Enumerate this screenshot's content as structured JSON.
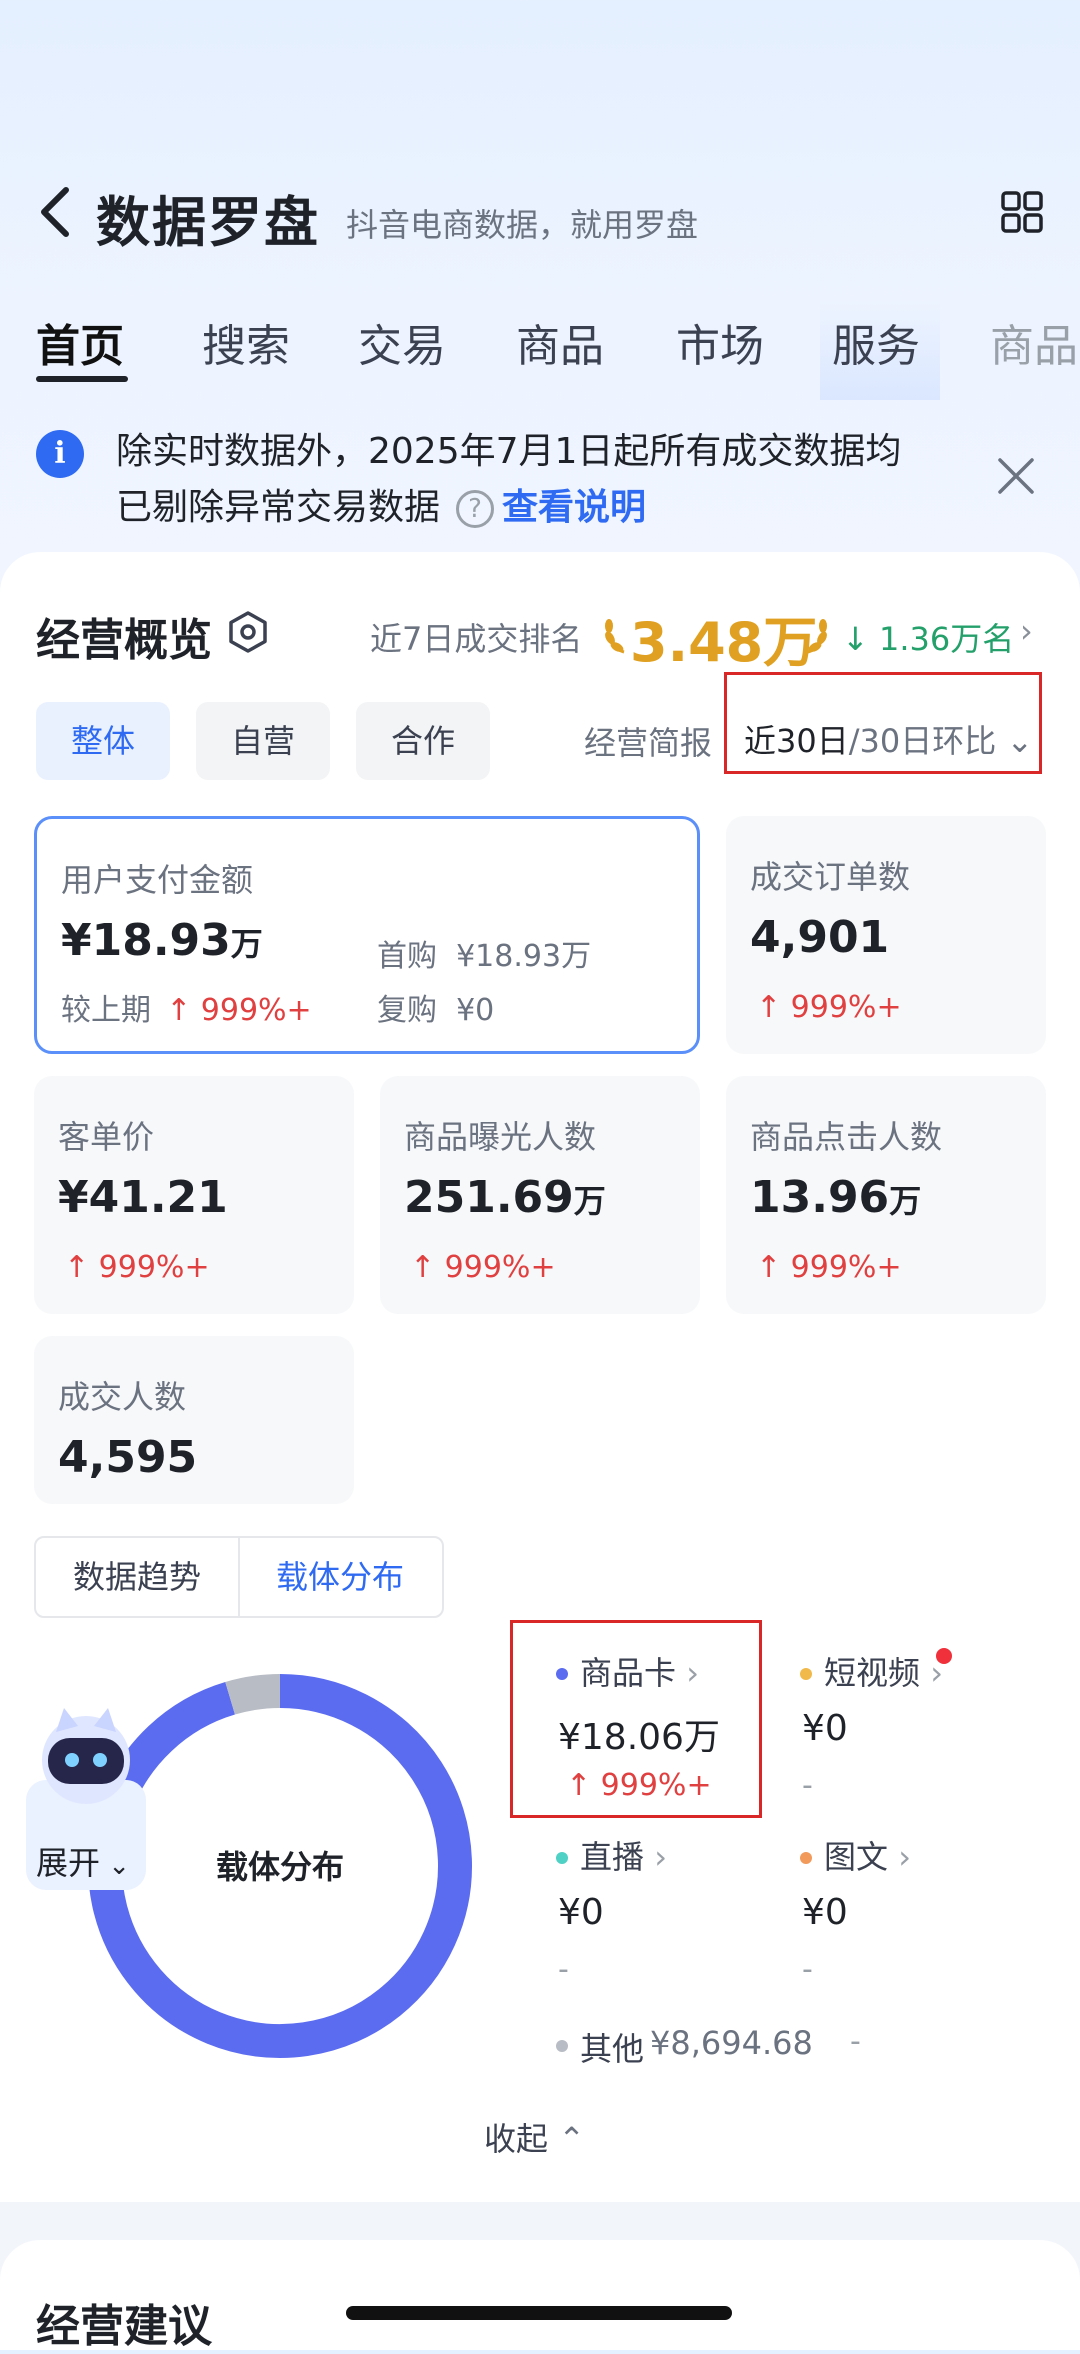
{
  "header": {
    "title": "数据罗盘",
    "subtitle": "抖音电商数据，就用罗盘"
  },
  "tabs": [
    "首页",
    "搜索",
    "交易",
    "商品",
    "市场",
    "服务",
    "商品"
  ],
  "notice": {
    "line1": "除实时数据外，2025年7月1日起所有成交数据均",
    "line2": "已剔除异常交易数据",
    "help_icon": "?",
    "link": "查看说明"
  },
  "overview": {
    "title": "经营概览",
    "rank_label": "近7日成交排名",
    "rank_value": "3.48万",
    "rank_change": "1.36万名",
    "chips": [
      "整体",
      "自营",
      "合作"
    ],
    "report_label": "经营简报",
    "period_main": "近30日",
    "period_sub": "/30日环比"
  },
  "metrics": {
    "pay_amount": {
      "label": "用户支付金额",
      "value": "¥18.93",
      "unit": "万",
      "compare_label": "较上期",
      "change": "↑ 999%+",
      "first_label": "首购",
      "first_value": "¥18.93万",
      "repeat_label": "复购",
      "repeat_value": "¥0"
    },
    "orders": {
      "label": "成交订单数",
      "value": "4,901",
      "change": "↑ 999%+"
    },
    "aov": {
      "label": "客单价",
      "value": "¥41.21",
      "change": "↑ 999%+"
    },
    "exposure": {
      "label": "商品曝光人数",
      "value": "251.69",
      "unit": "万",
      "change": "↑ 999%+"
    },
    "clicks": {
      "label": "商品点击人数",
      "value": "13.96",
      "unit": "万",
      "change": "↑ 999%+"
    },
    "buyers": {
      "label": "成交人数",
      "value": "4,595"
    }
  },
  "distribution": {
    "segments": [
      "数据趋势",
      "载体分布"
    ],
    "donut_label": "载体分布",
    "robot_button": "展开",
    "legend": [
      {
        "name": "商品卡",
        "value": "¥18.06万",
        "change": "↑ 999%+",
        "color": "#5b6cf0"
      },
      {
        "name": "短视频",
        "value": "¥0",
        "change": "-",
        "color": "#f0b94a"
      },
      {
        "name": "直播",
        "value": "¥0",
        "change": "-",
        "color": "#4fd1c5"
      },
      {
        "name": "图文",
        "value": "¥0",
        "change": "-",
        "color": "#f29a5b"
      },
      {
        "name": "其他",
        "value": "¥8,694.68",
        "change": "-",
        "color": "#b8bcc4"
      }
    ],
    "share": {
      "product_card": 0.954,
      "other": 0.046
    },
    "collapse_label": "收起"
  },
  "advice": {
    "title": "经营建议"
  },
  "colors": {
    "accent": "#2f6bf2",
    "up": "#e04040",
    "down": "#24a06b",
    "gold": "#e0a021",
    "highlight": "#d92626"
  }
}
